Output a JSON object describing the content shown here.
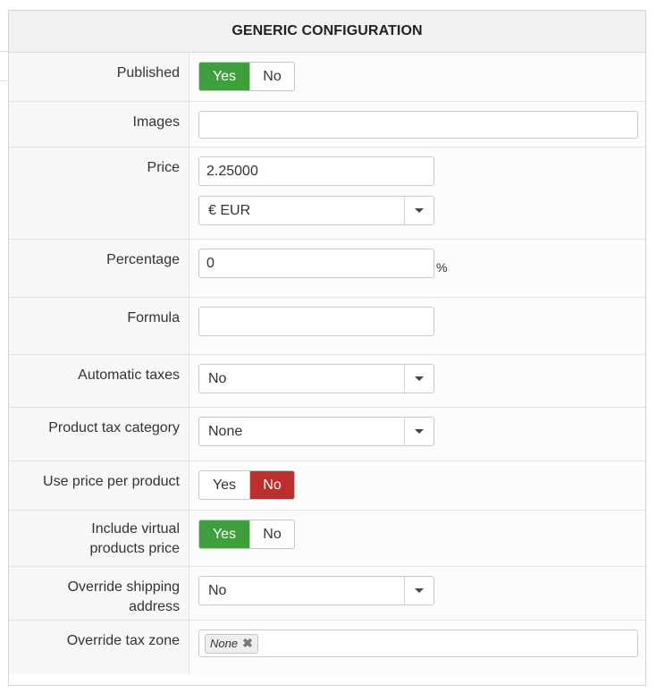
{
  "panel": {
    "title": "GENERIC CONFIGURATION"
  },
  "fields": {
    "published": {
      "label": "Published",
      "yes": "Yes",
      "no": "No",
      "value": "Yes"
    },
    "images": {
      "label": "Images",
      "value": ""
    },
    "price": {
      "label": "Price",
      "value": "2.25000",
      "currency": "€ EUR"
    },
    "percentage": {
      "label": "Percentage",
      "value": "0",
      "unit": "%"
    },
    "formula": {
      "label": "Formula",
      "value": ""
    },
    "automatic_taxes": {
      "label": "Automatic taxes",
      "value": "No"
    },
    "product_tax_category": {
      "label": "Product tax category",
      "value": "None"
    },
    "use_price_per_product": {
      "label": "Use price per product",
      "yes": "Yes",
      "no": "No",
      "value": "No"
    },
    "include_virtual": {
      "label_line1": "Include virtual",
      "label_line2": "products price",
      "yes": "Yes",
      "no": "No",
      "value": "Yes"
    },
    "override_shipping": {
      "label": "Override shipping address",
      "value": "No"
    },
    "override_tax_zone": {
      "label": "Override tax zone",
      "tag": "None"
    }
  },
  "colors": {
    "toggle_yes": "#3f9f3f",
    "toggle_no": "#bd2f2c",
    "header_bg": "#f1f1f1",
    "label_bg": "#f7f7f7"
  },
  "icons": {
    "select_caret": "caret-down-icon",
    "tag_remove": "close-icon"
  }
}
